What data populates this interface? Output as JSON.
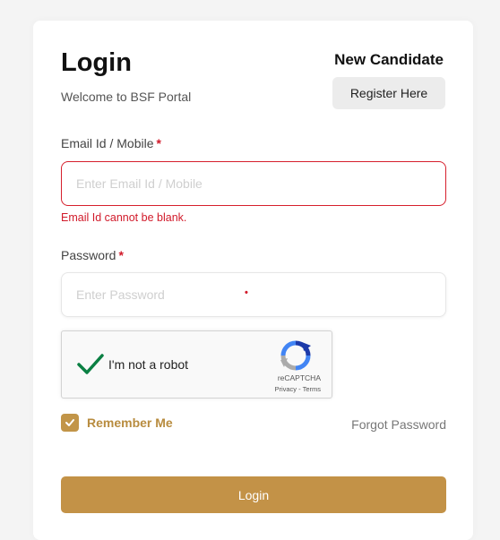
{
  "header": {
    "title": "Login",
    "subtitle": "Welcome to BSF Portal",
    "new_candidate_label": "New Candidate",
    "register_button": "Register Here"
  },
  "email": {
    "label": "Email Id / Mobile",
    "required_mark": "*",
    "placeholder": "Enter Email Id / Mobile",
    "value": "",
    "error": "Email Id cannot be blank."
  },
  "password": {
    "label": "Password",
    "required_mark": "*",
    "placeholder": "Enter Password",
    "value": "",
    "dot": "•"
  },
  "recaptcha": {
    "text": "I'm not a robot",
    "checked": true,
    "brand": "reCAPTCHA",
    "links": "Privacy - Terms",
    "check_color": "#0b8043",
    "logo_icon": "recaptcha-logo-icon"
  },
  "remember": {
    "label": "Remember Me",
    "checked": true
  },
  "forgot_link": "Forgot Password",
  "login_button": "Login",
  "colors": {
    "accent": "#c39247",
    "error": "#d11a2a",
    "background": "#f4f4f4"
  }
}
